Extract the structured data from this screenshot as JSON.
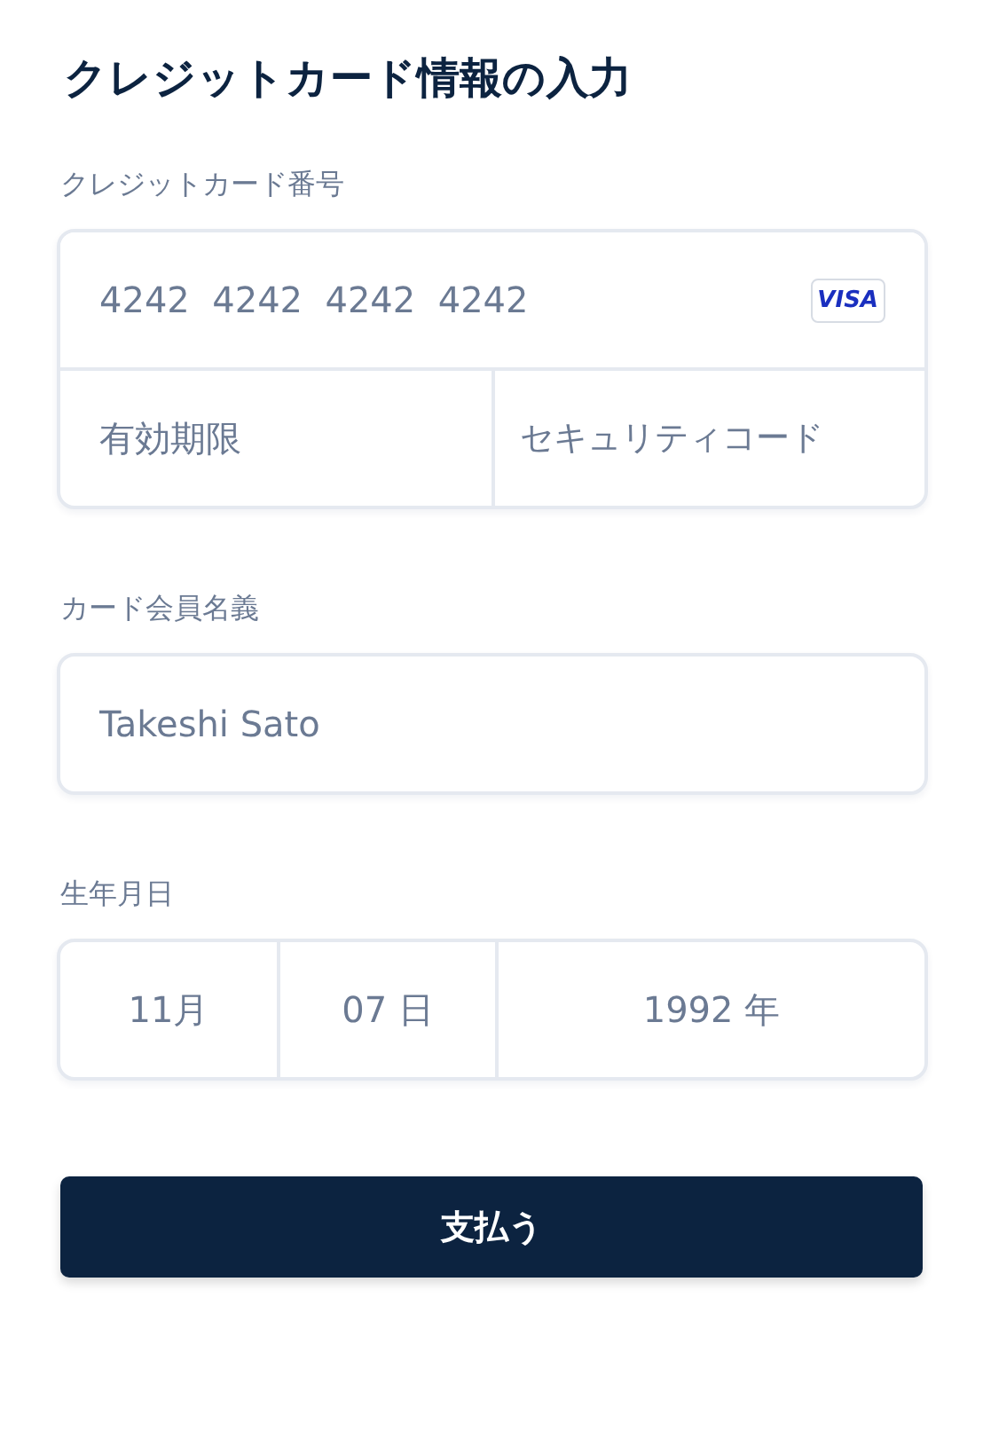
{
  "title": "クレジットカード情報の入力",
  "card_number": {
    "label": "クレジットカード番号",
    "placeholder": "4242  4242  4242  4242",
    "brand": "VISA",
    "expiry_placeholder": "有効期限",
    "security_placeholder": "セキュリティコード"
  },
  "cardholder": {
    "label": "カード会員名義",
    "placeholder": "Takeshi Sato"
  },
  "birthdate": {
    "label": "生年月日",
    "parts": [
      {
        "value": "11月"
      },
      {
        "value": "07 日"
      },
      {
        "value": "1992 年"
      }
    ]
  },
  "submit": "支払う"
}
